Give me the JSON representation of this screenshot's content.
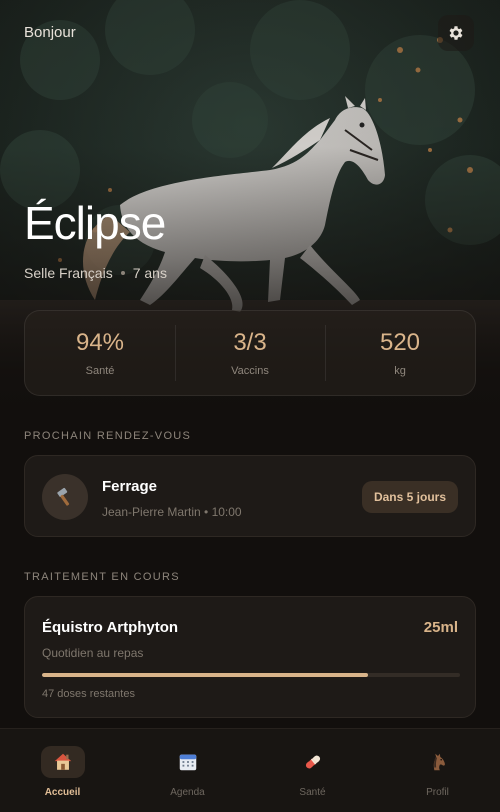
{
  "header": {
    "greeting": "Bonjour",
    "settings_icon": "gear-icon"
  },
  "horse": {
    "name": "Éclipse",
    "breed": "Selle Français",
    "age": "7 ans"
  },
  "stats": [
    {
      "value": "94%",
      "label": "Santé"
    },
    {
      "value": "3/3",
      "label": "Vaccins"
    },
    {
      "value": "520",
      "label": "kg"
    }
  ],
  "appointment": {
    "section_title": "PROCHAIN RENDEZ-VOUS",
    "icon": "hammer-icon",
    "title": "Ferrage",
    "subtitle": "Jean-Pierre Martin • 10:00",
    "badge": "Dans 5 jours"
  },
  "treatment": {
    "section_title": "TRAITEMENT EN COURS",
    "title": "Équistro Artphyton",
    "dose": "25ml",
    "frequency": "Quotidien au repas",
    "progress_fraction": 0.78,
    "remaining": "47 doses restantes"
  },
  "nav": {
    "items": [
      {
        "label": "Accueil",
        "icon": "house-icon",
        "active": true
      },
      {
        "label": "Agenda",
        "icon": "calendar-icon",
        "active": false
      },
      {
        "label": "Santé",
        "icon": "pill-icon",
        "active": false
      },
      {
        "label": "Profil",
        "icon": "horse-head-icon",
        "active": false
      }
    ]
  },
  "colors": {
    "accent": "#d9b48a",
    "background": "#120f0d",
    "card": "#1e1a17"
  }
}
